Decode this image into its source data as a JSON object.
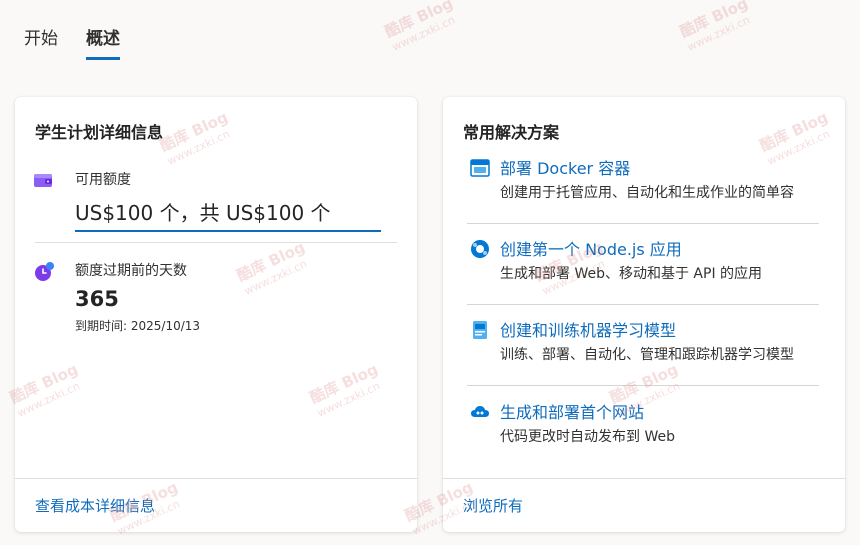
{
  "tabs": [
    {
      "label": "开始"
    },
    {
      "label": "概述"
    }
  ],
  "left_card": {
    "title": "学生计划详细信息",
    "credit_label": "可用额度",
    "credit_value": "US$100 个，共 US$100 个",
    "days_label": "额度过期前的天数",
    "days_value": "365",
    "expiry_text": "到期时间: 2025/10/13",
    "footer_link": "查看成本详细信息"
  },
  "right_card": {
    "title": "常用解决方案",
    "solutions": [
      {
        "title": "部署 Docker 容器",
        "desc": "创建用于托管应用、自动化和生成作业的简单容器",
        "icon": "docker-container-icon"
      },
      {
        "title": "创建第一个 Node.js 应用",
        "desc": "生成和部署 Web、移动和基于 API 的应用",
        "icon": "nodejs-app-icon"
      },
      {
        "title": "创建和训练机器学习模型",
        "desc": "训练、部署、自动化、管理和跟踪机器学习模型",
        "icon": "machine-learning-icon"
      },
      {
        "title": "生成和部署首个网站",
        "desc": "代码更改时自动发布到 Web",
        "icon": "website-cloud-icon"
      }
    ],
    "footer_link": "浏览所有"
  },
  "watermark": {
    "brand": "酷库 Blog",
    "url": "www.zxki.cn"
  },
  "colors": {
    "accent": "#0f6cbd",
    "background": "#faf9f8",
    "card": "#ffffff"
  }
}
